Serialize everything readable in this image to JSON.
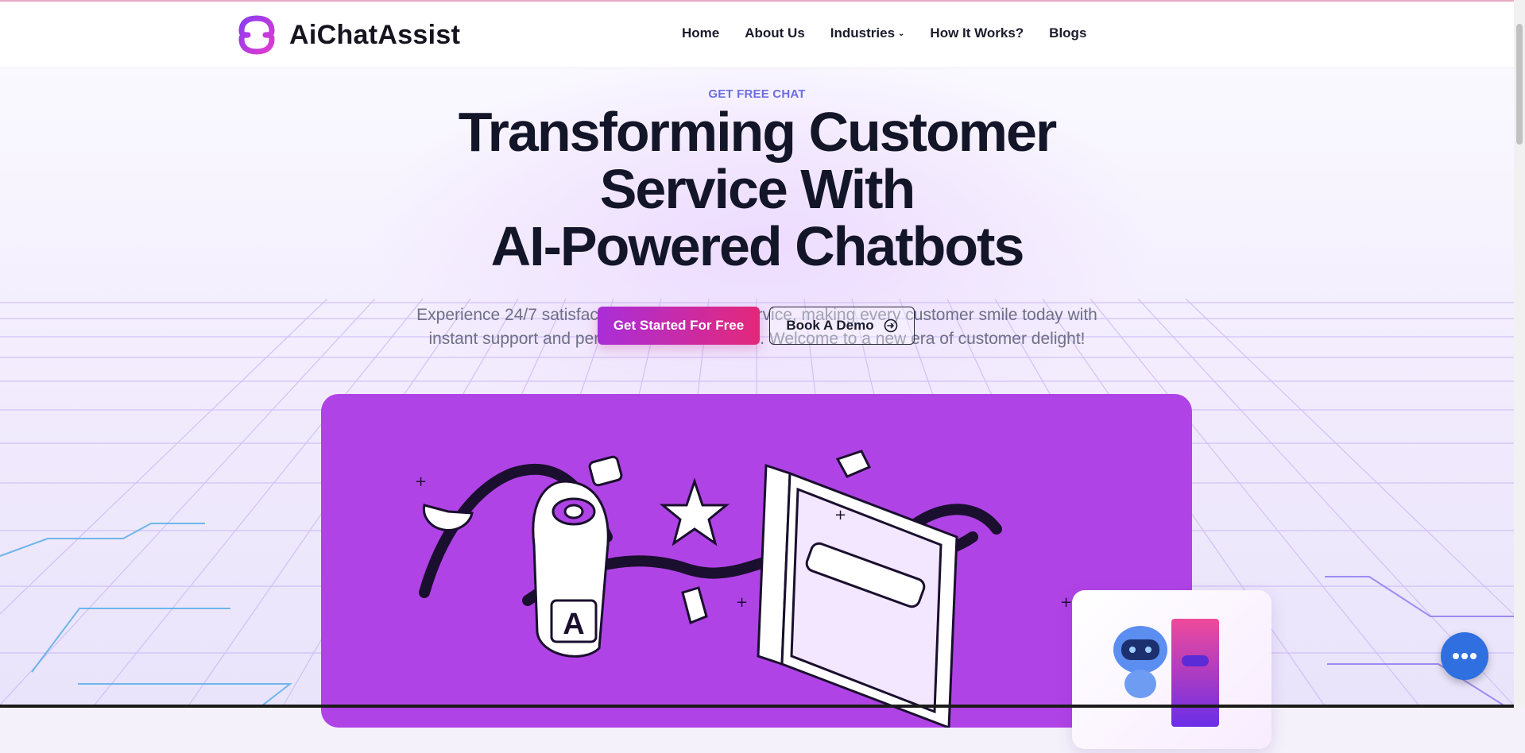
{
  "header": {
    "brand": "AiChatAssist",
    "nav": [
      {
        "label": "Home"
      },
      {
        "label": "About Us"
      },
      {
        "label": "Industries"
      },
      {
        "label": "How It Works?"
      },
      {
        "label": "Blogs"
      }
    ]
  },
  "hero": {
    "eyebrow": "GET FREE CHAT",
    "title_line1": "Transforming Customer",
    "title_line2": "Service With",
    "title_line3": "AI-Powered Chatbots",
    "subtitle_line1": "Experience 24/7 satisfaction! Revolutionize service, making every customer smile today with",
    "subtitle_line2": "instant support and personalized interactions. Welcome to a new era of customer delight!",
    "primary_cta": "Get Started For Free",
    "secondary_cta": "Book A Demo"
  },
  "illustration_letter": "A",
  "colors": {
    "accent": "#6b6ee2",
    "cta_gradient_start": "#a92ed8",
    "cta_gradient_end": "#e4287a",
    "illustration_bg": "#b043e6",
    "chat_fab": "#2f6fe0"
  },
  "icons": {
    "logo": "logo-mark-icon",
    "dropdown": "chevron-down-icon",
    "demo": "arrow-circle-icon",
    "chat": "chat-dots-icon"
  }
}
